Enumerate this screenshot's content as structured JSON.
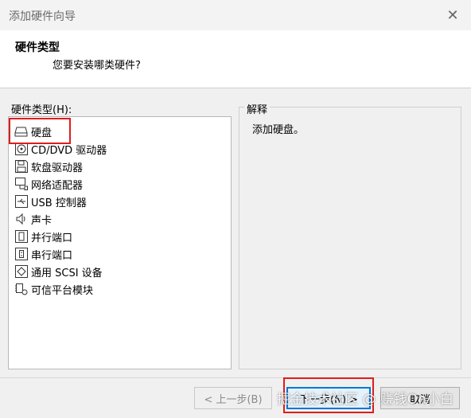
{
  "window": {
    "title": "添加硬件向导"
  },
  "header": {
    "title": "硬件类型",
    "subtitle": "您要安装哪类硬件?"
  },
  "list": {
    "label": "硬件类型(H):",
    "items": [
      {
        "label": "硬盘",
        "icon": "hard-disk-icon",
        "selected": true
      },
      {
        "label": "CD/DVD 驱动器",
        "icon": "cd-dvd-icon"
      },
      {
        "label": "软盘驱动器",
        "icon": "floppy-icon"
      },
      {
        "label": "网络适配器",
        "icon": "network-adapter-icon"
      },
      {
        "label": "USB 控制器",
        "icon": "usb-icon"
      },
      {
        "label": "声卡",
        "icon": "speaker-icon"
      },
      {
        "label": "并行端口",
        "icon": "parallel-port-icon"
      },
      {
        "label": "串行端口",
        "icon": "serial-port-icon"
      },
      {
        "label": "通用 SCSI 设备",
        "icon": "scsi-icon"
      },
      {
        "label": "可信平台模块",
        "icon": "tpm-icon"
      }
    ]
  },
  "description": {
    "legend": "解释",
    "text": "添加硬盘。"
  },
  "buttons": {
    "back": "< 上一步(B)",
    "next": "下一步(N) >",
    "cancel": "取消"
  },
  "watermark": "掘金技术社区 @ 赚钱On小白",
  "colors": {
    "highlight_box": "#e01c1c",
    "focus": "#0078d4"
  }
}
